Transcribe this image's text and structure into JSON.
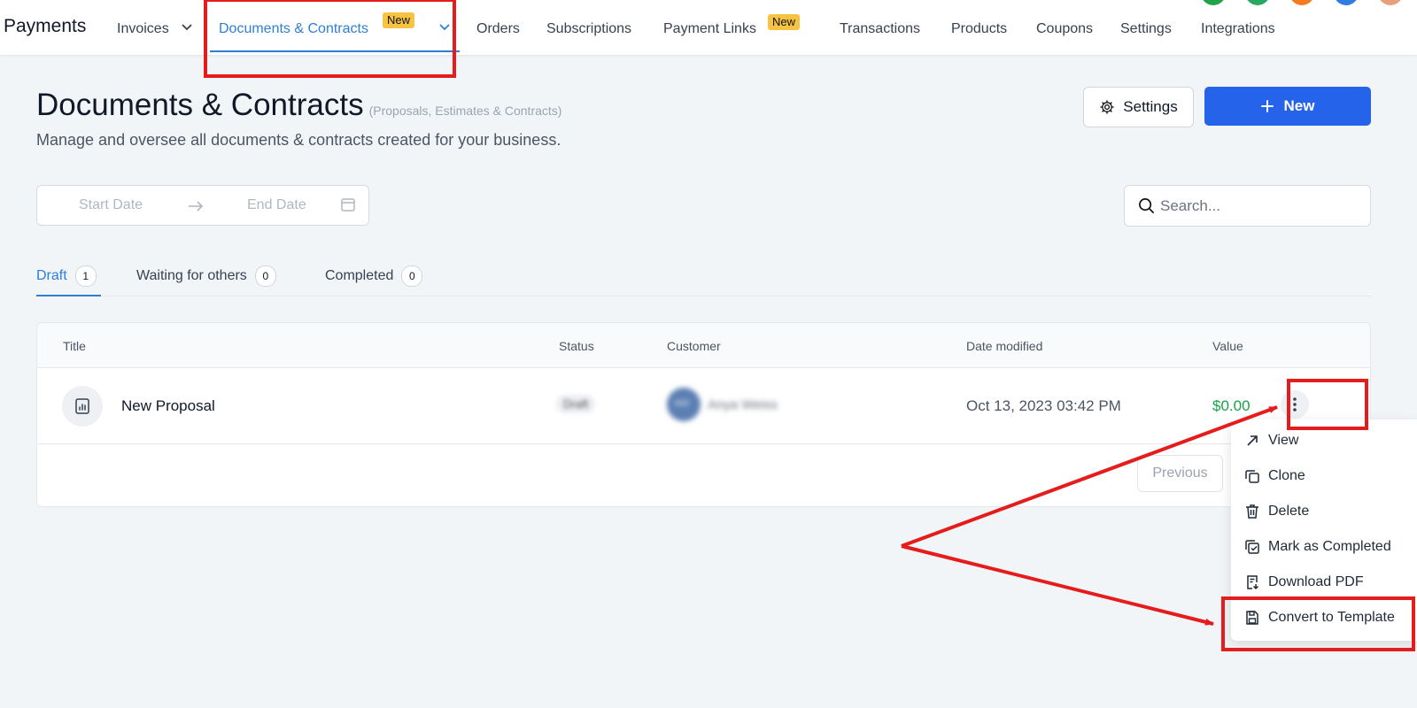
{
  "nav": {
    "brand": "Payments",
    "items": [
      {
        "label": "Invoices"
      },
      {
        "label": "Documents & Contracts",
        "badge": "New"
      },
      {
        "label": "Orders"
      },
      {
        "label": "Subscriptions"
      },
      {
        "label": "Payment Links",
        "badge": "New"
      },
      {
        "label": "Transactions"
      },
      {
        "label": "Products"
      },
      {
        "label": "Coupons"
      },
      {
        "label": "Settings"
      },
      {
        "label": "Integrations"
      }
    ]
  },
  "header": {
    "title": "Documents & Contracts",
    "subtitle": "(Proposals, Estimates & Contracts)",
    "description": "Manage and oversee all documents & contracts created for your business.",
    "settings_label": "Settings",
    "new_label": "New"
  },
  "filters": {
    "start_placeholder": "Start Date",
    "end_placeholder": "End Date",
    "search_placeholder": "Search..."
  },
  "tabs": [
    {
      "label": "Draft",
      "count": "1"
    },
    {
      "label": "Waiting for others",
      "count": "0"
    },
    {
      "label": "Completed",
      "count": "0"
    }
  ],
  "table": {
    "columns": [
      "Title",
      "Status",
      "Customer",
      "Date modified",
      "Value"
    ],
    "rows": [
      {
        "title": "New Proposal",
        "status": "Draft",
        "customer": "Anya Weiss",
        "customer_initials": "AW",
        "date_modified": "Oct 13, 2023 03:42 PM",
        "value": "$0.00"
      }
    ],
    "previous_label": "Previous"
  },
  "row_menu": {
    "items": [
      {
        "label": "View",
        "icon": "arrow-up-right-icon"
      },
      {
        "label": "Clone",
        "icon": "copy-icon"
      },
      {
        "label": "Delete",
        "icon": "trash-icon"
      },
      {
        "label": "Mark as Completed",
        "icon": "check-square-icon"
      },
      {
        "label": "Download PDF",
        "icon": "file-download-icon"
      },
      {
        "label": "Convert to Template",
        "icon": "save-icon"
      }
    ]
  },
  "colors": {
    "accent": "#2d7fd3",
    "primary_button": "#2563eb",
    "badge": "#f6c343",
    "value": "#16a34a",
    "annotation": "#e41c1c"
  }
}
